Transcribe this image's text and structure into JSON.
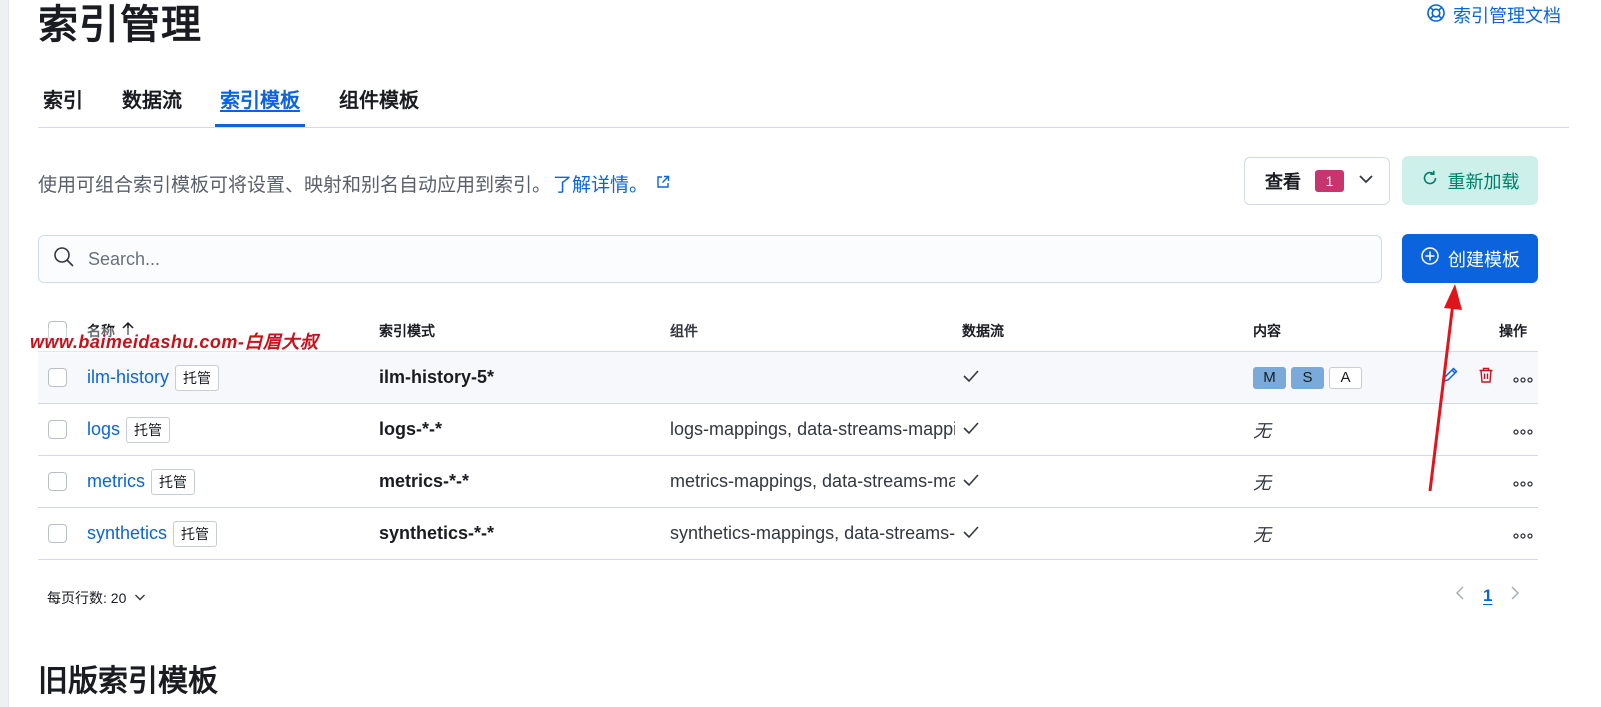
{
  "page": {
    "title": "索引管理",
    "doc_link_label": "索引管理文档"
  },
  "tabs": [
    {
      "label": "索引",
      "active": false
    },
    {
      "label": "数据流",
      "active": false
    },
    {
      "label": "索引模板",
      "active": true
    },
    {
      "label": "组件模板",
      "active": false
    }
  ],
  "description": {
    "text": "使用可组合索引模板可将设置、映射和别名自动应用到索引。",
    "learn_more": "了解详情。"
  },
  "toolbar": {
    "view_label": "查看",
    "view_count": "1",
    "reload_label": "重新加载",
    "create_label": "创建模板"
  },
  "search": {
    "placeholder": "Search...",
    "value": ""
  },
  "table": {
    "headers": {
      "name": "名称",
      "pattern": "索引模式",
      "components": "组件",
      "data_stream": "数据流",
      "content": "内容",
      "actions": "操作"
    },
    "managed_label": "托管",
    "rows": [
      {
        "name": "ilm-history",
        "pattern": "ilm-history-5*",
        "components": "",
        "data_stream": true,
        "content": [
          "M",
          "S",
          "A"
        ],
        "content_none": ""
      },
      {
        "name": "logs",
        "pattern": "logs-*-*",
        "components": "logs-mappings, data-streams-mappings, logs-settings",
        "data_stream": true,
        "content": [],
        "content_none": "无"
      },
      {
        "name": "metrics",
        "pattern": "metrics-*-*",
        "components": "metrics-mappings, data-streams-mappings, metrics-settings",
        "data_stream": true,
        "content": [],
        "content_none": "无"
      },
      {
        "name": "synthetics",
        "pattern": "synthetics-*-*",
        "components": "synthetics-mappings, data-streams-mappings, synthetics-settings",
        "data_stream": true,
        "content": [],
        "content_none": "无"
      }
    ]
  },
  "pagination": {
    "rows_per_page_label": "每页行数: 20",
    "current_page": "1"
  },
  "legacy": {
    "title": "旧版索引模板"
  },
  "watermark": {
    "text": "www.baimeidashu.com-白眉大叔"
  },
  "colors": {
    "primary": "#0b64dd",
    "success_light": "#cdf0ea",
    "success_text": "#00806b",
    "count_badge": "#c8346d",
    "danger": "#c7121a"
  }
}
